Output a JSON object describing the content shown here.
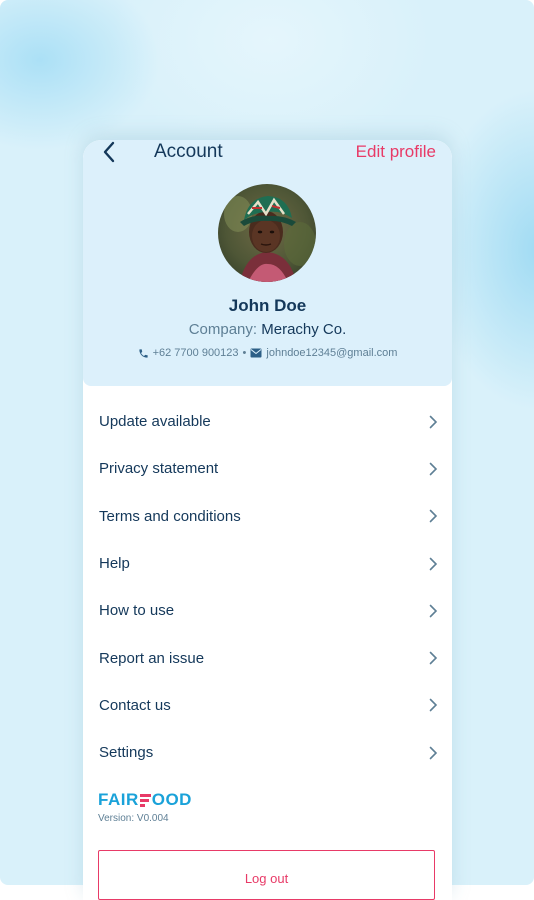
{
  "header": {
    "title": "Account",
    "edit_label": "Edit profile"
  },
  "profile": {
    "name": "John Doe",
    "company_label": "Company:",
    "company": "Merachy Co.",
    "phone": "+62 7700 900123",
    "separator": "•",
    "email": "johndoe12345@gmail.com"
  },
  "menu": {
    "items": [
      {
        "label": "Update available"
      },
      {
        "label": "Privacy statement"
      },
      {
        "label": "Terms and conditions"
      },
      {
        "label": "Help"
      },
      {
        "label": "How to use"
      },
      {
        "label": "Report an issue"
      },
      {
        "label": "Contact us"
      },
      {
        "label": "Settings"
      }
    ]
  },
  "brand": {
    "logo_text_left": "FAIR",
    "logo_text_right": "OOD",
    "version": "Version: V0.004"
  },
  "logout_label": "Log out",
  "colors": {
    "primary_text": "#14385a",
    "accent_red": "#e83a67",
    "brand_blue": "#1aa2d9",
    "card_bg": "#dcf0fb"
  },
  "icons": {
    "back": "chevron-left-icon",
    "menu_arrow": "chevron-right-icon",
    "phone": "phone-icon",
    "email": "mail-icon"
  }
}
